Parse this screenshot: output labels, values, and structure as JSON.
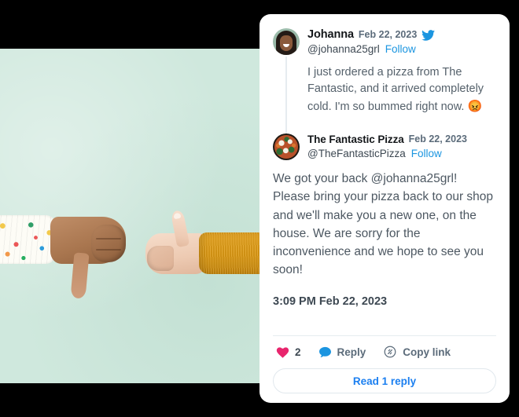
{
  "photo": {
    "alt": "two hands giving thumbs down and thumbs up on mint green background",
    "background_color": "#cfe8dd",
    "left_hand": "thumbs-down hand in floral sleeve",
    "right_hand": "thumbs-up hand in mustard knit sweater"
  },
  "card": {
    "background_color": "#ffffff",
    "quoted_tweet": {
      "avatar": "johanna-avatar",
      "display_name": "Johanna",
      "date": "Feb 22, 2023",
      "verified_icon": "twitter-bird-icon",
      "handle": "@johanna25grl",
      "follow_label": "Follow",
      "body": "I just ordered a pizza from The Fantastic, and it arrived completely cold. I'm so bummed right now.",
      "body_emoji": "😡"
    },
    "main_tweet": {
      "avatar": "the-fantastic-pizza-avatar",
      "display_name": "The Fantastic Pizza",
      "date": "Feb 22, 2023",
      "handle": "@TheFantasticPizza",
      "follow_label": "Follow",
      "body": "We got your back @johanna25grl! Please bring your pizza back to our shop and we'll make you a new one, on the house. We are sorry for the inconvenience and we hope to see you soon!",
      "timestamp": "3:09 PM Feb 22, 2023"
    },
    "actions": {
      "like": {
        "icon": "heart-icon",
        "count": "2",
        "color": "#e8256d"
      },
      "reply": {
        "icon": "speech-bubble-icon",
        "label": "Reply",
        "color": "#1b95e0"
      },
      "copy_link": {
        "icon": "link-icon",
        "label": "Copy link",
        "color": "#5b6b7a"
      }
    },
    "read_reply_label": "Read 1 reply",
    "accent_color": "#1b95e0",
    "link_color": "#1b7ff0"
  }
}
